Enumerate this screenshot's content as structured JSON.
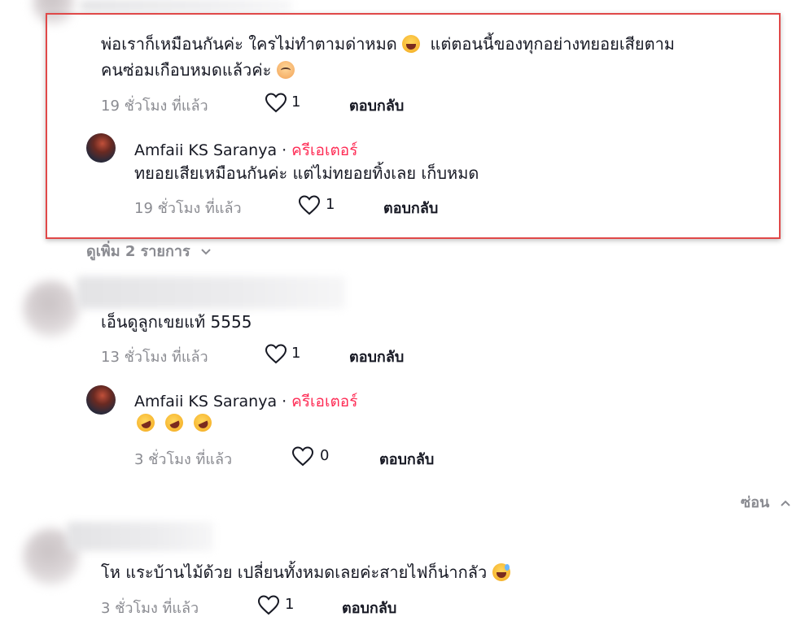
{
  "comments": [
    {
      "text_line1": "พ่อเราก็เหมือนกันค่ะ ใครไม่ทำตามด่าหมด",
      "text_line1b": "แต่ตอนนี้ของทุกอย่างทยอยเสียตาม",
      "text_line2": "คนซ่อมเกือบหมดแล้วค่ะ",
      "time": "19 ชั่วโมง ที่แล้ว",
      "likes": "1",
      "reply_label": "ตอบกลับ",
      "reply": {
        "author": "Amfaii KS Saranya",
        "separator": "·",
        "badge": "ครีเอเตอร์",
        "text": "ทยอยเสียเหมือนกันค่ะ แต่ไม่ทยอยทิ้งเลย เก็บหมด",
        "time": "19 ชั่วโมง ที่แล้ว",
        "likes": "1",
        "reply_label": "ตอบกลับ"
      },
      "view_more": "ดูเพิ่ม 2 รายการ"
    },
    {
      "text": "เอ็นดูลูกเขยแท้ 5555",
      "time": "13 ชั่วโมง ที่แล้ว",
      "likes": "1",
      "reply_label": "ตอบกลับ",
      "reply": {
        "author": "Amfaii KS Saranya",
        "separator": "·",
        "badge": "ครีเอเตอร์",
        "time": "3 ชั่วโมง ที่แล้ว",
        "likes": "0",
        "reply_label": "ตอบกลับ"
      },
      "hide": "ซ่อน"
    },
    {
      "text": "โห แระบ้านไม้ด้วย เปลี่ยนทั้งหมดเลยค่ะสายไฟก็น่ากลัว",
      "time": "3 ชั่วโมง ที่แล้ว",
      "likes": "1",
      "reply_label": "ตอบกลับ"
    }
  ],
  "icons": {
    "like": "heart-outline-icon",
    "chevron_down": "chevron-down-icon",
    "chevron_up": "chevron-up-icon"
  },
  "colors": {
    "creator_badge": "#fe2c55",
    "highlight_border": "#e04848",
    "meta_text": "#8a8b91"
  }
}
